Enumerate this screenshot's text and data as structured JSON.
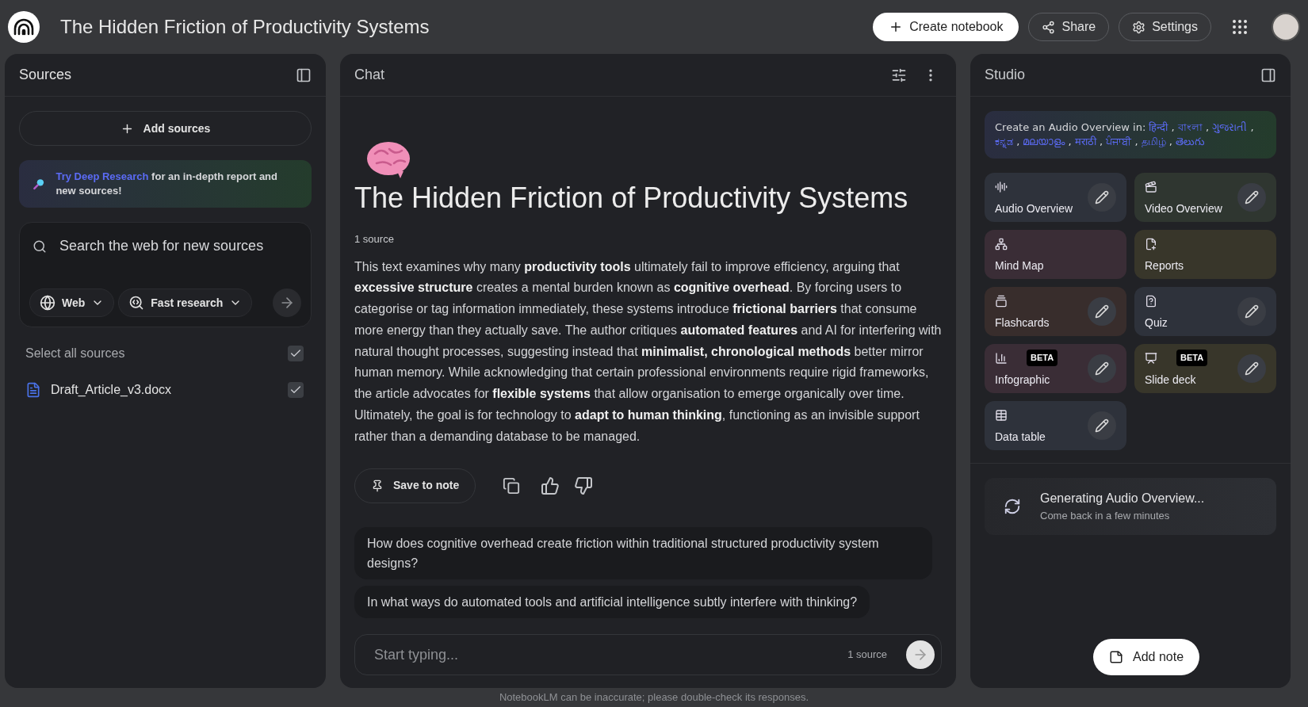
{
  "app_bar": {
    "title": "The Hidden Friction of Productivity Systems",
    "buttons": [
      {
        "kind": "primary",
        "label": "Create notebook"
      },
      {
        "kind": "share",
        "label": "Share"
      },
      {
        "kind": "settings",
        "label": "Settings"
      }
    ]
  },
  "sources": {
    "title": "Sources",
    "add_button": "Add sources",
    "promo": {
      "link": "Try Deep Research",
      "text": " for an in-depth report and new sources!"
    },
    "search": {
      "placeholder": "Search the web for new sources",
      "chips": [
        {
          "kind": "web",
          "label": "Web"
        },
        {
          "kind": "research",
          "label": "Fast research"
        }
      ]
    },
    "select_all": {
      "label": "Select all sources",
      "checked": true
    },
    "items": [
      {
        "name": "Draft_Article_v3.docx",
        "checked": true
      }
    ]
  },
  "chat": {
    "title": "Chat",
    "heading": "The Hidden Friction of Productivity Systems",
    "source_count": "1 source",
    "summary": "This text examines why many **productivity tools** ultimately fail to improve efficiency, arguing that **excessive structure** creates a mental burden known as **cognitive overhead**. By forcing users to categorise or tag information immediately, these systems introduce **frictional barriers** that consume more energy than they actually save. The author critiques **automated features** and AI for interfering with natural thought processes, suggesting instead that **minimalist, chronological methods** better mirror human memory. While acknowledging that certain professional environments require rigid frameworks, the article advocates for **flexible systems** that allow organisation to emerge organically over time. Ultimately, the goal is for technology to **adapt to human thinking**, functioning as an invisible support rather than a demanding database to be managed.",
    "save_button": "Save to note",
    "suggestions": [
      "How does cognitive overhead create friction within traditional structured productivity system designs?",
      "In what ways do automated tools and artificial intelligence subtly interfere with thinking?"
    ],
    "input": {
      "placeholder": "Start typing...",
      "source_count": "1 source"
    }
  },
  "studio": {
    "title": "Studio",
    "banner": {
      "text": "Create an Audio Overview in: ",
      "separator": ",",
      "languages": [
        "हिन्दी",
        "বাংলা",
        "ગુજરાતી",
        "ಕನ್ನಡ",
        "മലയാളം",
        "मराठी",
        "ਪੰਜਾਬੀ",
        "தமிழ்",
        "తెలుగు"
      ]
    },
    "tiles": [
      {
        "label": "Audio Overview",
        "color": "#2e323b",
        "editable": true
      },
      {
        "label": "Video Overview",
        "color": "#2f3630",
        "editable": true
      },
      {
        "label": "Mind Map",
        "color": "#3a2d36",
        "editable": false
      },
      {
        "label": "Reports",
        "color": "#38362a",
        "editable": false
      },
      {
        "label": "Flashcards",
        "color": "#382d2c",
        "editable": true
      },
      {
        "label": "Quiz",
        "color": "#2e323b",
        "editable": true
      },
      {
        "label": "Infographic",
        "color": "#3a2d36",
        "editable": true,
        "badge": "BETA"
      },
      {
        "label": "Slide deck",
        "color": "#38362a",
        "editable": true,
        "badge": "BETA"
      },
      {
        "label": "Data table",
        "color": "#2e323b",
        "editable": true
      }
    ],
    "generating": {
      "title": "Generating Audio Overview...",
      "subtitle": "Come back in a few minutes"
    },
    "add_note": "Add note"
  },
  "footer": "NotebookLM can be inaccurate; please double-check its responses."
}
